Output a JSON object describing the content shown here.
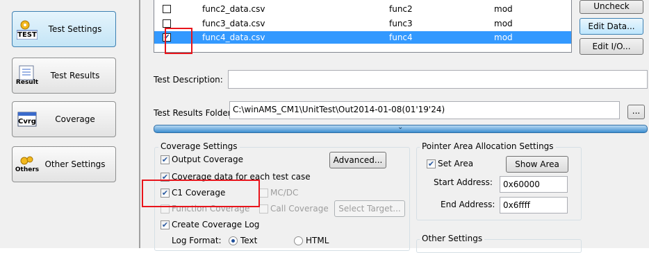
{
  "nav": {
    "items": [
      {
        "label": "Test Settings",
        "icon_text": "TEST",
        "icon": "test-settings-icon"
      },
      {
        "label": "Test Results",
        "icon_text": "Result",
        "icon": "test-results-icon"
      },
      {
        "label": "Coverage",
        "icon_text": "Cvrg",
        "icon": "coverage-icon"
      },
      {
        "label": "Other Settings",
        "icon_text": "Others",
        "icon": "other-settings-icon"
      }
    ]
  },
  "file_list": {
    "rows": [
      {
        "name": "func2_data.csv",
        "func": "func2",
        "type": "mod",
        "checked": false,
        "selected": false
      },
      {
        "name": "func3_data.csv",
        "func": "func3",
        "type": "mod",
        "checked": false,
        "selected": false
      },
      {
        "name": "func4_data.csv",
        "func": "func4",
        "type": "mod",
        "checked": true,
        "selected": true
      }
    ]
  },
  "side_buttons": {
    "uncheck": "Uncheck",
    "edit_data": "Edit Data...",
    "edit_io": "Edit I/O..."
  },
  "test_description": {
    "label": "Test Description:",
    "value": ""
  },
  "results_folder": {
    "label": "Test Results Folder:",
    "value": "C:\\winAMS_CM1\\UnitTest\\Out2014-01-08(01'19'24)",
    "browse": "..."
  },
  "splitter": {
    "glyph": "»"
  },
  "coverage_settings": {
    "title": "Coverage Settings",
    "output_coverage": "Output Coverage",
    "advanced": "Advanced...",
    "per_test_case": "Coverage data for each test case",
    "c1": "C1 Coverage",
    "mcdc": "MC/DC",
    "function_coverage": "Function Coverage",
    "call_coverage": "Call Coverage",
    "select_target": "Select Target...",
    "create_log": "Create Coverage Log",
    "log_format_label": "Log Format:",
    "format_text": "Text",
    "format_html": "HTML"
  },
  "pointer_settings": {
    "title": "Pointer Area Allocation Settings",
    "set_area": "Set Area",
    "show_area": "Show Area",
    "start_label": "Start Address:",
    "start_value": "0x60000",
    "end_label": "End Address:",
    "end_value": "0x6ffff"
  },
  "other_settings": {
    "title": "Other Settings"
  },
  "colors": {
    "selection": "#3399ff",
    "highlight_box": "#e8141b",
    "splitter": "#3d8ed0"
  }
}
